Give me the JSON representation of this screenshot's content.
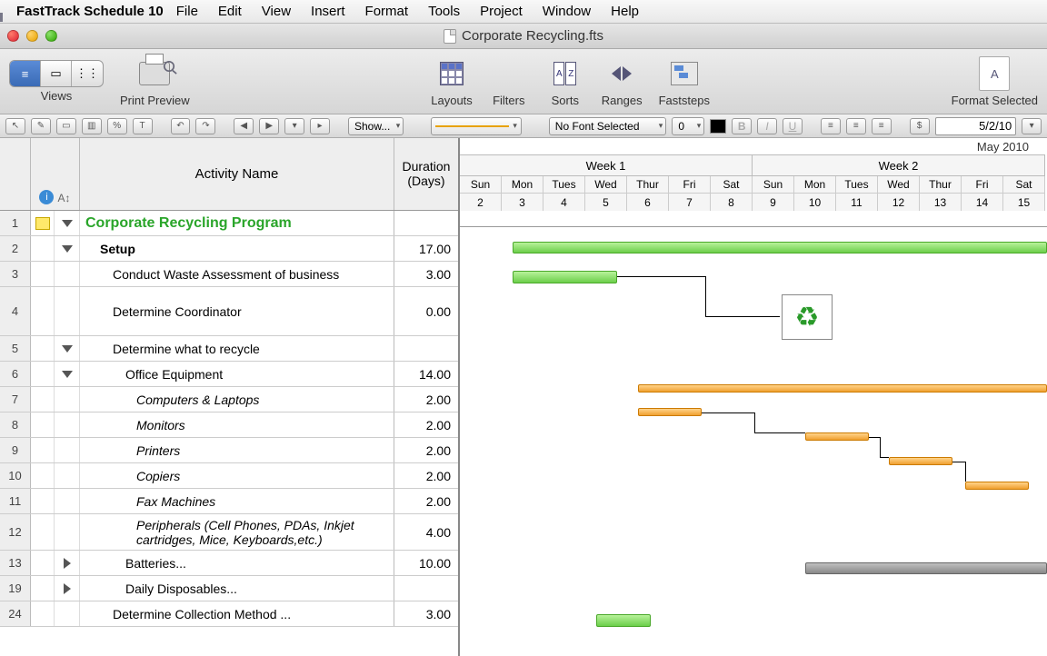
{
  "menubar": {
    "app": "FastTrack Schedule 10",
    "items": [
      "File",
      "Edit",
      "View",
      "Insert",
      "Format",
      "Tools",
      "Project",
      "Window",
      "Help"
    ]
  },
  "window": {
    "title": "Corporate Recycling.fts"
  },
  "toolbar": {
    "views": "Views",
    "print_preview": "Print Preview",
    "layouts": "Layouts",
    "filters": "Filters",
    "sorts": "Sorts",
    "ranges": "Ranges",
    "faststeps": "Faststeps",
    "format_selected": "Format Selected"
  },
  "subtoolbar": {
    "show": "Show...",
    "font": "No Font Selected",
    "size": "0",
    "date": "5/2/10",
    "currency": "$"
  },
  "columns": {
    "activity": "Activity Name",
    "duration": "Duration (Days)"
  },
  "timeline": {
    "month": "May 2010",
    "weeks": [
      "Week 1",
      "Week 2"
    ],
    "dows": [
      "Sun",
      "Mon",
      "Tues",
      "Wed",
      "Thur",
      "Fri",
      "Sat",
      "Sun",
      "Mon",
      "Tues",
      "Wed",
      "Thur",
      "Fri",
      "Sat"
    ],
    "days": [
      "2",
      "3",
      "4",
      "5",
      "6",
      "7",
      "8",
      "9",
      "10",
      "11",
      "12",
      "13",
      "14",
      "15"
    ]
  },
  "rows": [
    {
      "n": "1",
      "name": "Corporate Recycling Program",
      "dur": "",
      "cls": "r1",
      "ind": 0,
      "disc": "down",
      "note": true
    },
    {
      "n": "2",
      "name": "Setup",
      "dur": "17.00",
      "cls": "r2",
      "ind": 1,
      "disc": "down"
    },
    {
      "n": "3",
      "name": "Conduct Waste Assessment of business",
      "dur": "3.00",
      "ind": 2
    },
    {
      "n": "4",
      "name": "Determine Coordinator",
      "dur": "0.00",
      "ind": 2,
      "cls": "r4"
    },
    {
      "n": "5",
      "name": "Determine what to recycle",
      "dur": "",
      "ind": 2,
      "disc": "down"
    },
    {
      "n": "6",
      "name": "Office Equipment",
      "dur": "14.00",
      "ind": 3,
      "disc": "down"
    },
    {
      "n": "7",
      "name": "Computers & Laptops",
      "dur": "2.00",
      "ind": 4,
      "italic": true
    },
    {
      "n": "8",
      "name": "Monitors",
      "dur": "2.00",
      "ind": 4,
      "italic": true
    },
    {
      "n": "9",
      "name": "Printers",
      "dur": "2.00",
      "ind": 4,
      "italic": true
    },
    {
      "n": "10",
      "name": "Copiers",
      "dur": "2.00",
      "ind": 4,
      "italic": true
    },
    {
      "n": "11",
      "name": "Fax Machines",
      "dur": "2.00",
      "ind": 4,
      "italic": true
    },
    {
      "n": "12",
      "name": "Peripherals (Cell Phones, PDAs, Inkjet cartridges, Mice, Keyboards,etc.)",
      "dur": "4.00",
      "ind": 4,
      "italic": true,
      "cls": "r12"
    },
    {
      "n": "13",
      "name": "Batteries...",
      "dur": "10.00",
      "ind": 3,
      "disc": "right"
    },
    {
      "n": "19",
      "name": "Daily Disposables...",
      "dur": "",
      "ind": 3,
      "disc": "right"
    },
    {
      "n": "24",
      "name": "Determine Collection Method ...",
      "dur": "3.00",
      "ind": 2
    }
  ]
}
